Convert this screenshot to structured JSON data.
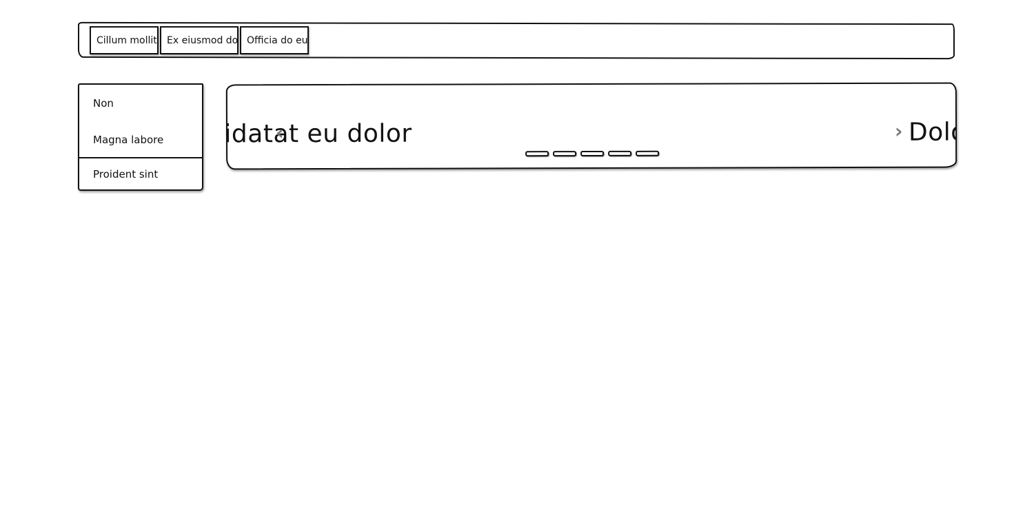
{
  "navbar": {
    "tabs": [
      {
        "label": "Cillum mollit"
      },
      {
        "label": "Ex eiusmod do"
      },
      {
        "label": "Officia do eu"
      }
    ]
  },
  "sidebar": {
    "items": [
      {
        "label": "Non"
      },
      {
        "label": "Magna labore"
      },
      {
        "label": "Proident sint"
      }
    ]
  },
  "carousel": {
    "slide_left_text": "pidatat eu dolor",
    "slide_right_text": "Dolo",
    "prev_icon": "‹",
    "next_icon": "›",
    "indicator_count": 5
  }
}
